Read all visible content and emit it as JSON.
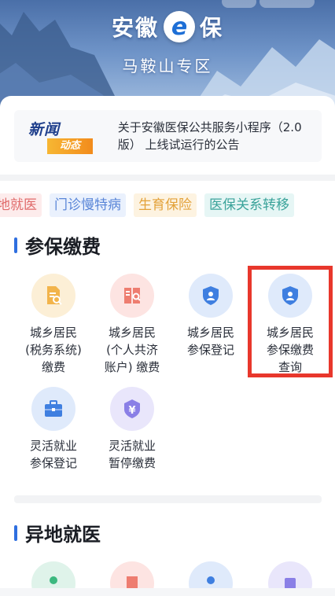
{
  "header": {
    "logo_left": "安徽",
    "logo_mid": "e",
    "logo_right": "保",
    "region": "马鞍山专区"
  },
  "news": {
    "badge_top": "新闻",
    "badge_bottom": "动态",
    "text": "关于安徽医保公共服务小程序（2.0版） 上线试运行的公告"
  },
  "tags": [
    "地就医",
    "门诊慢特病",
    "生育保险",
    "医保关系转移"
  ],
  "sections": {
    "payment": {
      "title": "参保缴费",
      "items": [
        {
          "label_l1": "城乡居民",
          "label_l2": "(税务系统)",
          "label_l3": "缴费",
          "icon": "document-search-icon"
        },
        {
          "label_l1": "城乡居民",
          "label_l2": "(个人共济",
          "label_l3": "账户) 缴费",
          "icon": "book-search-icon"
        },
        {
          "label_l1": "城乡居民",
          "label_l2": "参保登记",
          "label_l3": "",
          "icon": "shield-user-icon"
        },
        {
          "label_l1": "城乡居民",
          "label_l2": "参保缴费",
          "label_l3": "查询",
          "icon": "shield-user-icon"
        },
        {
          "label_l1": "灵活就业",
          "label_l2": "参保登记",
          "label_l3": "",
          "icon": "briefcase-icon"
        },
        {
          "label_l1": "灵活就业",
          "label_l2": "暂停缴费",
          "label_l3": "",
          "icon": "yuan-shield-icon"
        }
      ]
    },
    "remote": {
      "title": "异地就医"
    }
  },
  "colors": {
    "accent": "#2f6fe0",
    "highlight": "#e8372c"
  }
}
